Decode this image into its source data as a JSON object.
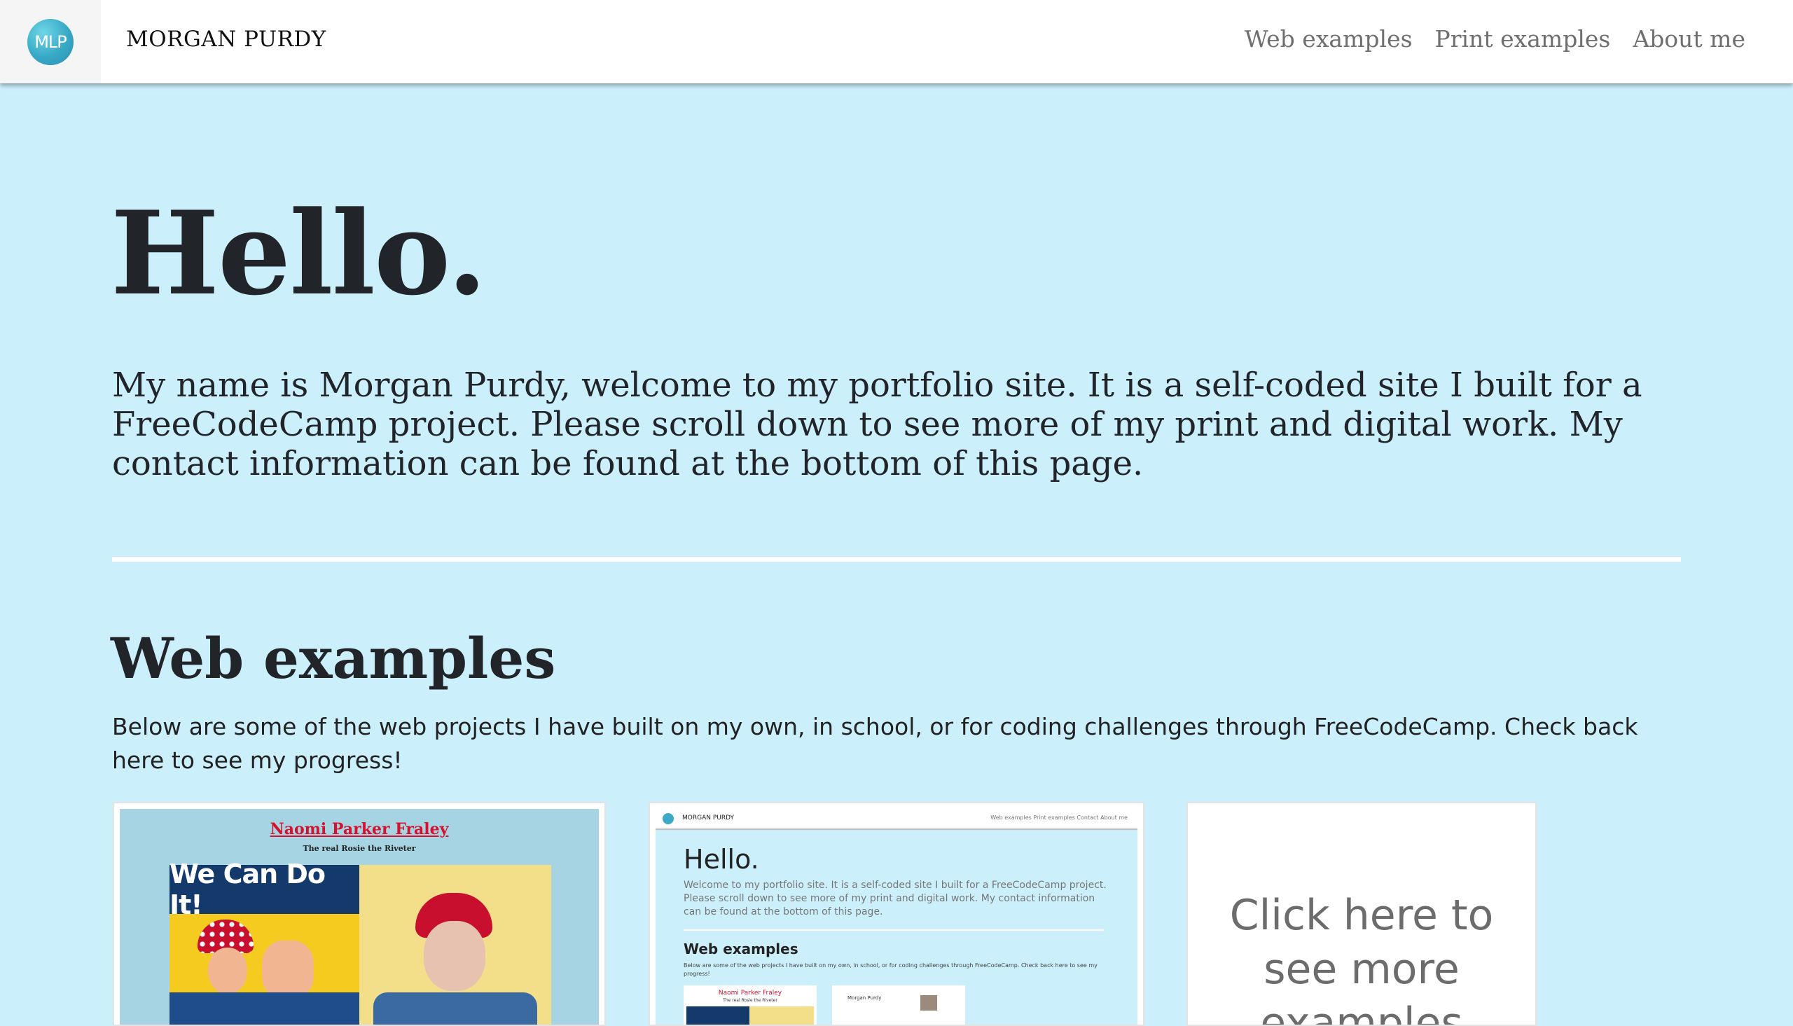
{
  "nav": {
    "logo_text": "MLP",
    "brand": "MORGAN PURDY",
    "links": [
      "Web examples",
      "Print examples",
      "About me"
    ]
  },
  "hero": {
    "title": "Hello.",
    "text": "My name is Morgan Purdy, welcome to my portfolio site. It is a self-coded site I built for a FreeCodeCamp project. Please scroll down to see more of my print and digital work. My contact information can be found at the bottom of this page."
  },
  "web_examples": {
    "title": "Web examples",
    "text": "Below are some of the web projects I have built on my own, in school, or for coding challenges through FreeCodeCamp. Check back here to see my progress!",
    "cards": [
      {
        "title": "Naomi Parker Fraley",
        "subtitle": "The real Rosie the Riveter",
        "poster_text": "We Can Do It!"
      },
      {
        "brand": "MORGAN PURDY",
        "links": "Web examples   Print examples   Contact   About me",
        "hello": "Hello.",
        "text": "Welcome to my portfolio site. It is a self-coded site I built for a FreeCodeCamp project. Please scroll down to see more of my print and digital work. My contact information can be found at the bottom of this page.",
        "section_title": "Web examples",
        "section_text": "Below are some of the web projects I have built on my own, in school, or for coding challenges through FreeCodeCamp. Check back here to see my progress!",
        "mini_card1_title": "Naomi Parker Fraley",
        "mini_card1_sub": "The real Rosie the Riveter",
        "mini_card2_title": "Morgan Purdy"
      },
      {
        "text": "Click here to see more examples"
      }
    ]
  },
  "colors": {
    "background": "#cbeffb",
    "navbar": "#ffffff",
    "accent_red": "#d6102d"
  }
}
